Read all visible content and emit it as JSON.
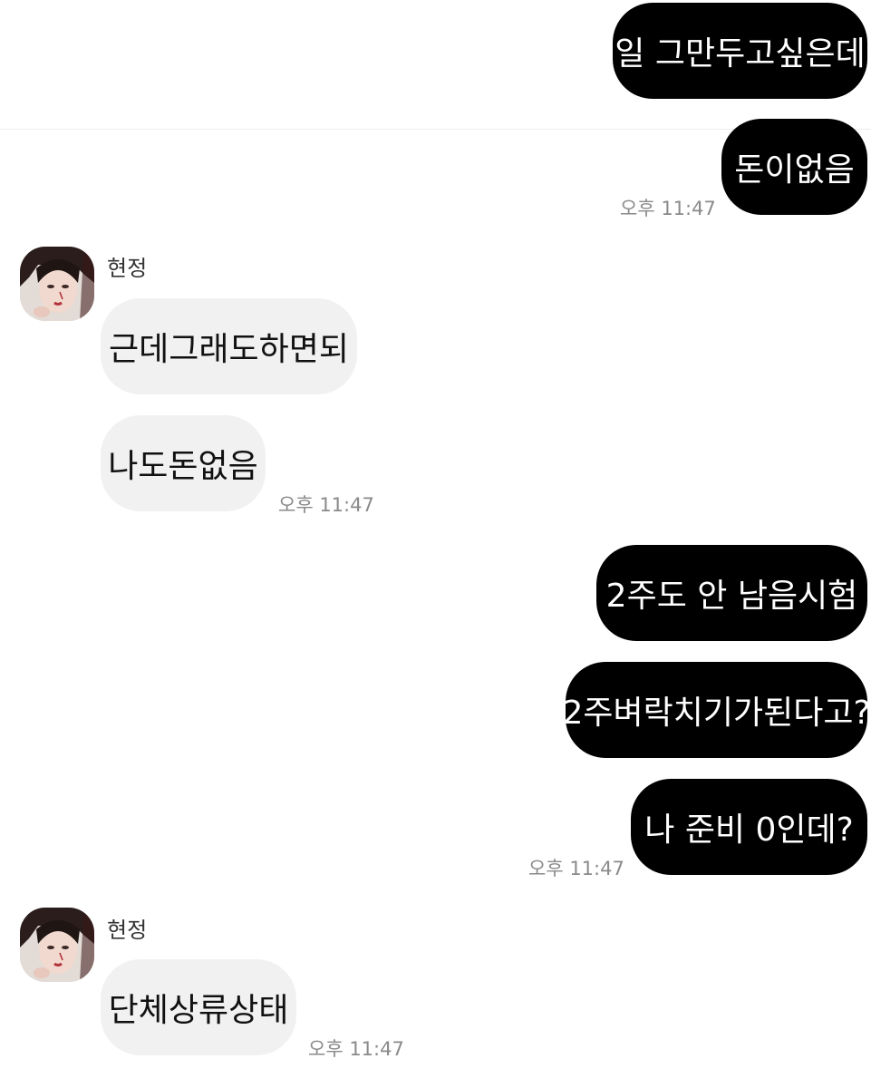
{
  "chat": {
    "sender_name": "현정",
    "messages": {
      "m1": "일 그만두고싶은데",
      "m2": "돈이없음",
      "m3": "근데그래도하면되",
      "m4": "나도돈없음",
      "m5": "2주도 안 남음시험",
      "m6": "2주벼락치기가된다고?",
      "m7": "나 준비 0인데?",
      "m8": "단체상류상태"
    },
    "times": {
      "t1": "오후 11:47",
      "t2": "오후 11:47",
      "t3": "오후 11:47",
      "t4": "오후 11:47"
    }
  },
  "colors": {
    "outgoing_bubble": "#000000",
    "incoming_bubble": "#f1f1f1",
    "timestamp": "#8a8a8a"
  },
  "icons": {
    "avatar": "profile-photo"
  }
}
